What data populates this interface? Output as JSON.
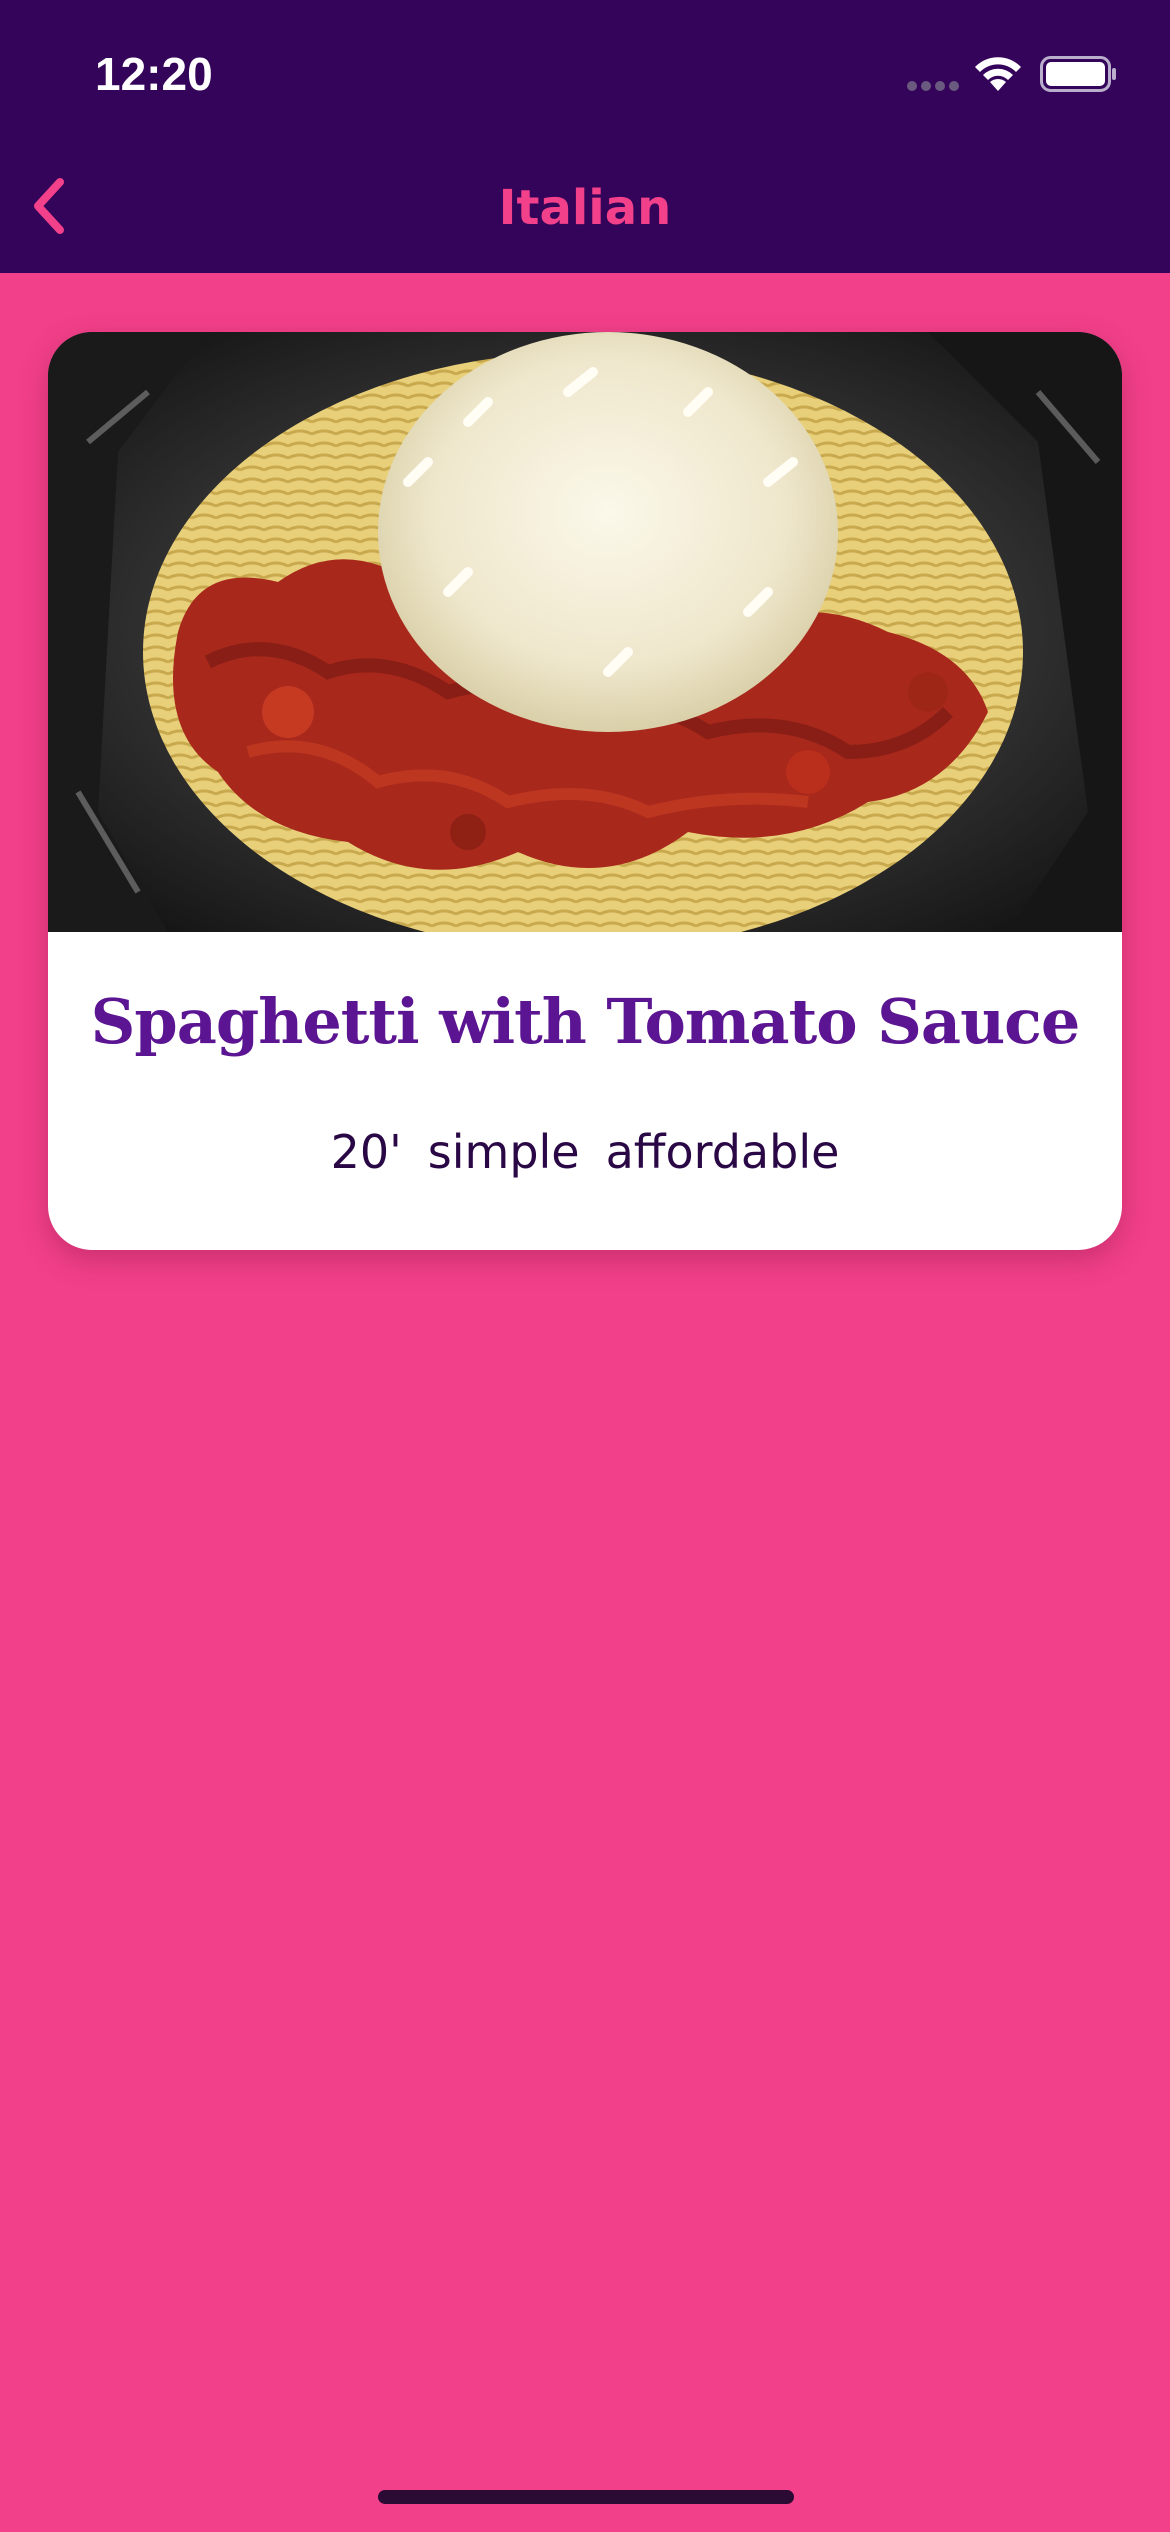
{
  "status_bar": {
    "time": "12:20"
  },
  "nav": {
    "title": "Italian",
    "back_icon": "chevron-left-icon"
  },
  "meal": {
    "title": "Spaghetti with Tomato Sauce",
    "duration": "20'",
    "complexity": "simple",
    "affordability": "affordable"
  },
  "colors": {
    "header": "#34045a",
    "background": "#f2408a",
    "accent": "#f2408a",
    "title": "#5c1592",
    "meta_text": "#2a0846"
  }
}
